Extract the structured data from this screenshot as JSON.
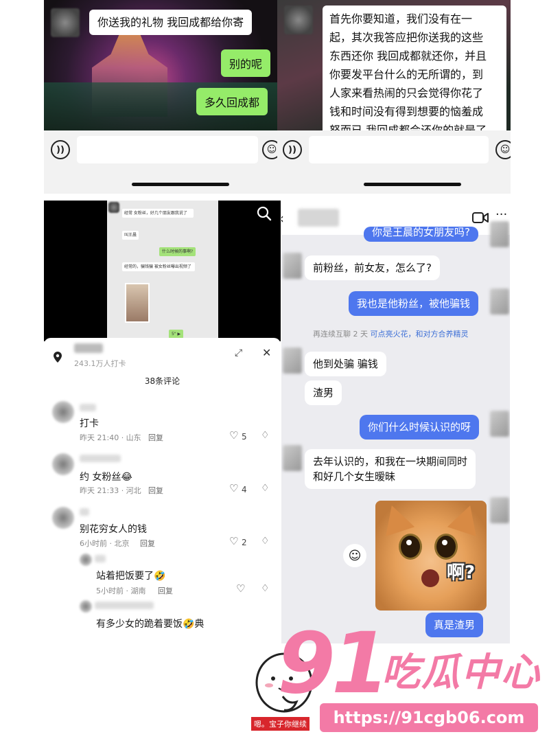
{
  "top_left_chat": {
    "message_received": "你送我的礼物 我回成都给你寄",
    "message_sent_1": "别的呢",
    "message_sent_2": "多久回成都",
    "voice_icon": "voice-icon",
    "emoji_icon": "emoji-icon"
  },
  "top_right_chat": {
    "message_lines": [
      "首先你要知道，我们没有在一",
      "起，其次我答应把你送我的这些",
      "东西还你 我回成都就还你，并且",
      "你要发平台什么的无所谓的，到",
      "人家来看热闹的只会觉得你花了",
      "钱和时间没有得到想要的恼羞成",
      "怒而已 我回成都会还你的就是了"
    ]
  },
  "video_screenshot": {
    "mini_messages": [
      "经常  女粉丝，好几个朋友跟我说了",
      "叫王晨",
      "什么时候的事啊?",
      "经常的，骗钱骗   被女粉丝曝出视频了",
      "5\" ▶"
    ],
    "search_icon": "search-icon"
  },
  "comments_panel": {
    "location_count": "243.1万人打卡",
    "comment_count": "38条评论",
    "items": [
      {
        "text": "打卡",
        "meta": "昨天 21:40 · 山东",
        "reply": "回复",
        "likes": "5"
      },
      {
        "text": "约  女粉丝😂",
        "meta": "昨天 21:33 · 河北",
        "reply": "回复",
        "likes": "4"
      },
      {
        "text": "别花穷女人的钱",
        "meta": "6小时前 · 北京",
        "reply": "回复",
        "likes": "2"
      }
    ],
    "replies": [
      {
        "text": "站着把饭要了🤣",
        "meta": "5小时前 · 湖南",
        "reply": "回复"
      },
      {
        "text": "有多少女的跪着要饭🤣典"
      }
    ]
  },
  "bottom_right_chat": {
    "partial_top": "你是王晨的女朋友吗?",
    "msg_1": "前粉丝，前女友，怎么了?",
    "msg_2": "我也是他粉丝，被他骗钱",
    "system_note_prefix": "再连续互聊 2 天",
    "system_note_link": "可点亮火花，和对方合养精灵",
    "msg_3": "他到处骗  骗钱",
    "msg_4": "渣男",
    "msg_5": "你们什么时候认识的呀",
    "msg_6_line1": "去年认识的，和我在一块期间同时",
    "msg_6_line2": "和好几个女生暧昧  ",
    "sticker_text": "啊?",
    "msg_7": "真是渣男"
  },
  "watermark": {
    "number": "91",
    "title": "吃瓜中心",
    "url": "https://91cgb06.com",
    "mascot_caption": "嗯。宝子你继续"
  },
  "colors": {
    "wechat_green": "#95ec69",
    "chat_blue": "#4e77ee",
    "watermark_pink": "#f37aa6"
  }
}
